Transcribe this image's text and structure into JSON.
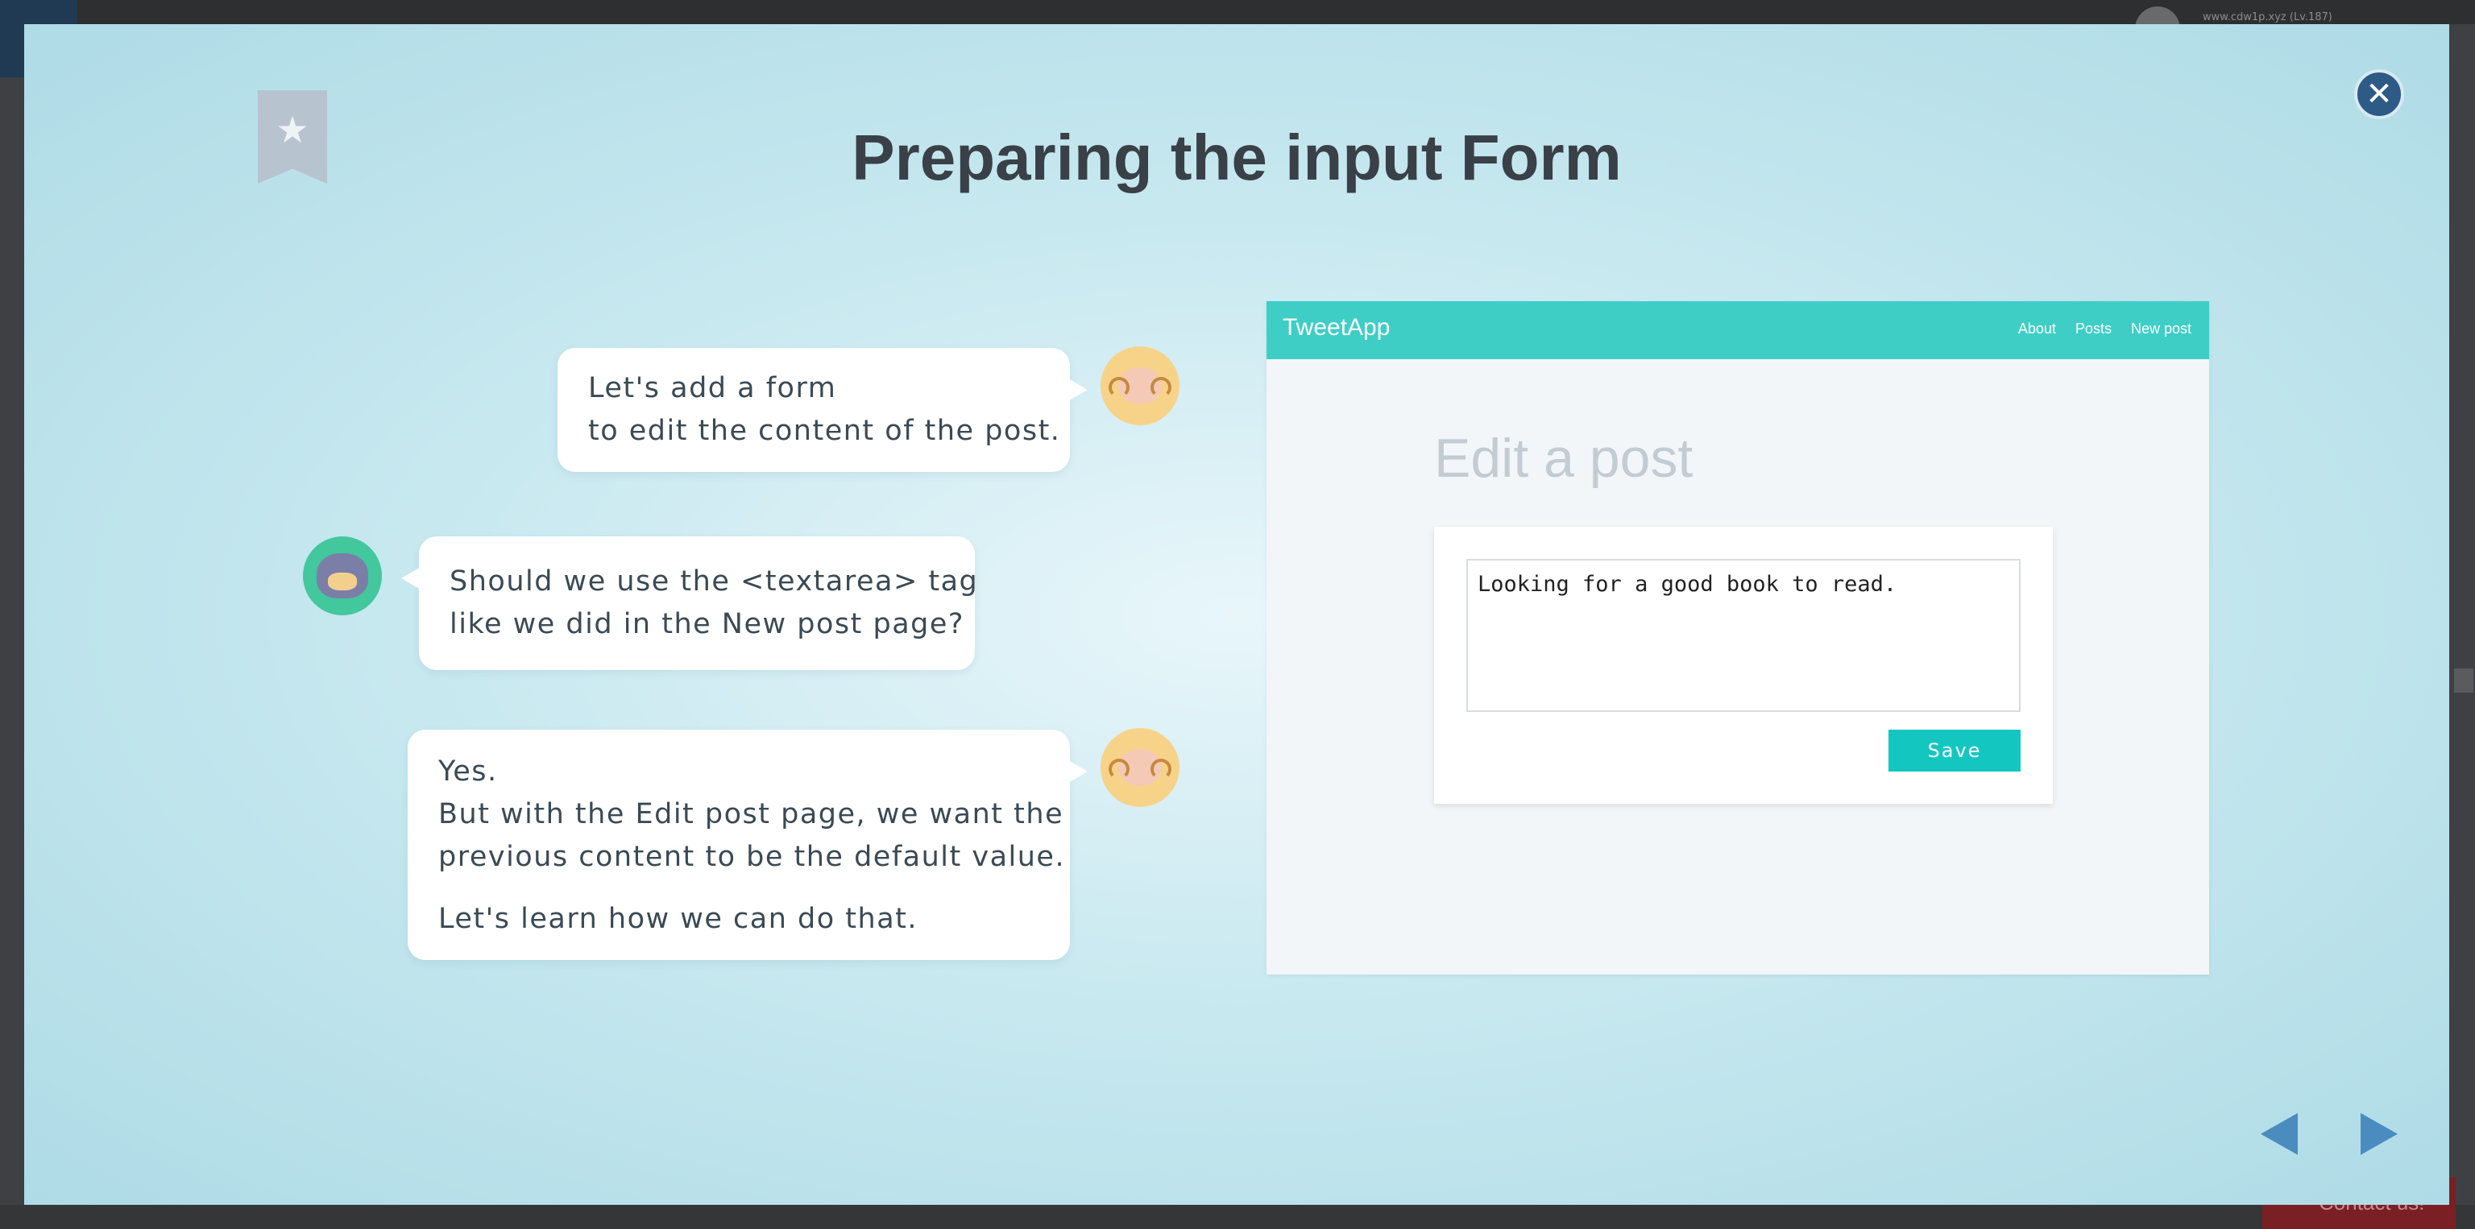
{
  "background": {
    "user_text": "www.cdw1p.xyz (Lv.187)",
    "contact_label": "Contact us!"
  },
  "modal": {
    "title": "Preparing the input Form",
    "bookmark_icon": "star-bookmark-icon",
    "close_icon": "close-x-icon",
    "close_glyph": "✕",
    "bookmark_glyph": "★"
  },
  "conversation": [
    {
      "speaker": "sheep",
      "lines": [
        "Let's add a form",
        "to edit the content of the post."
      ]
    },
    {
      "speaker": "cat",
      "lines": [
        "Should we use the <textarea> tag",
        "like we did in the New post page?"
      ]
    },
    {
      "speaker": "sheep",
      "lines": [
        "Yes.",
        "But with the Edit post page, we want the",
        "previous content to be the default value."
      ],
      "extra": "Let's learn how we can do that."
    }
  ],
  "preview": {
    "brand": "TweetApp",
    "nav_links": [
      "About",
      "Posts",
      "New post"
    ],
    "heading": "Edit a post",
    "textarea_value": "Looking for a good book to read.",
    "save_label": "Save",
    "accent_color": "#3ecec6"
  },
  "navigation": {
    "prev_icon": "triangle-left-icon",
    "next_icon": "triangle-right-icon"
  }
}
